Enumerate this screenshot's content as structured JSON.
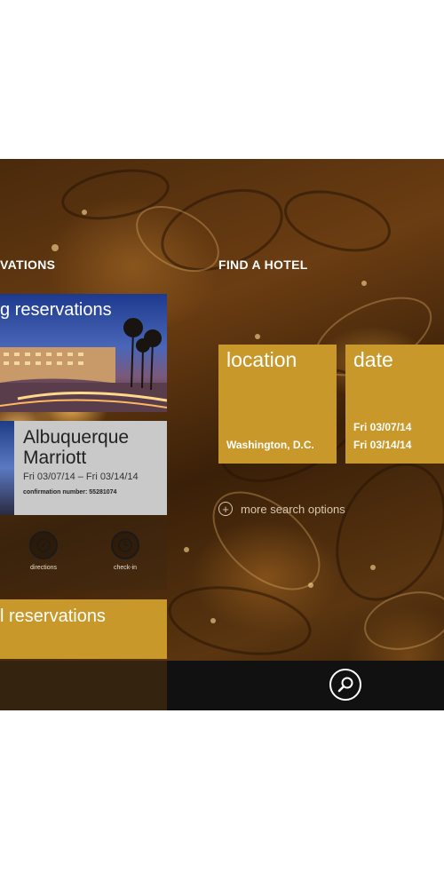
{
  "reservations": {
    "section_title": "VATIONS",
    "upcoming_title": "g reservations",
    "hotel": {
      "name_line1": "Albuquerque",
      "name_line2": "Marriott",
      "dates": "Fri 03/07/14 – Fri 03/14/14",
      "confirmation": "confirmation number: 55281074"
    },
    "actions": [
      {
        "label": "directions",
        "icon": "compass-icon"
      },
      {
        "label": "check-in",
        "icon": "clock-icon"
      }
    ],
    "past_title": "l reservations"
  },
  "find_hotel": {
    "section_title": "FIND A HOTEL",
    "location": {
      "heading": "location",
      "value": "Washington, D.C."
    },
    "date": {
      "heading": "date",
      "check_in": "Fri 03/07/14",
      "check_out": "Fri 03/14/14"
    },
    "more_options": "more search options"
  },
  "appbar": {
    "search_icon": "search-icon"
  },
  "colors": {
    "accent": "#c8982a",
    "tile_gray": "#c9c9c9",
    "appbar": "#111111"
  }
}
